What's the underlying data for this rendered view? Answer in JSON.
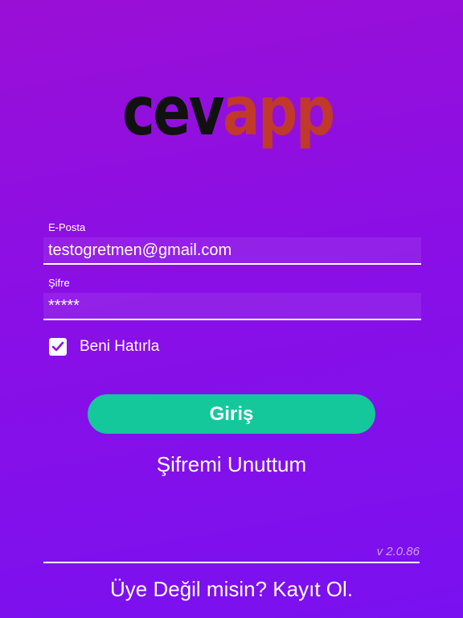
{
  "logo": {
    "part1": "cev",
    "part2": "app"
  },
  "email": {
    "label": "E-Posta",
    "value": "testogretmen@gmail.com"
  },
  "password": {
    "label": "Şifre",
    "value": "*****"
  },
  "remember": {
    "label": "Beni Hatırla",
    "checked": true
  },
  "login_button": "Giriş",
  "forgot_link": "Şifremi Unuttum",
  "version": "v 2.0.86",
  "register_link": "Üye Değil misin? Kayıt Ol.",
  "colors": {
    "background_top": "#9a0fd6",
    "background_bottom": "#7a10f0",
    "login_button": "#14c89c",
    "logo_dark": "#111111",
    "logo_accent": "#c0392b"
  }
}
